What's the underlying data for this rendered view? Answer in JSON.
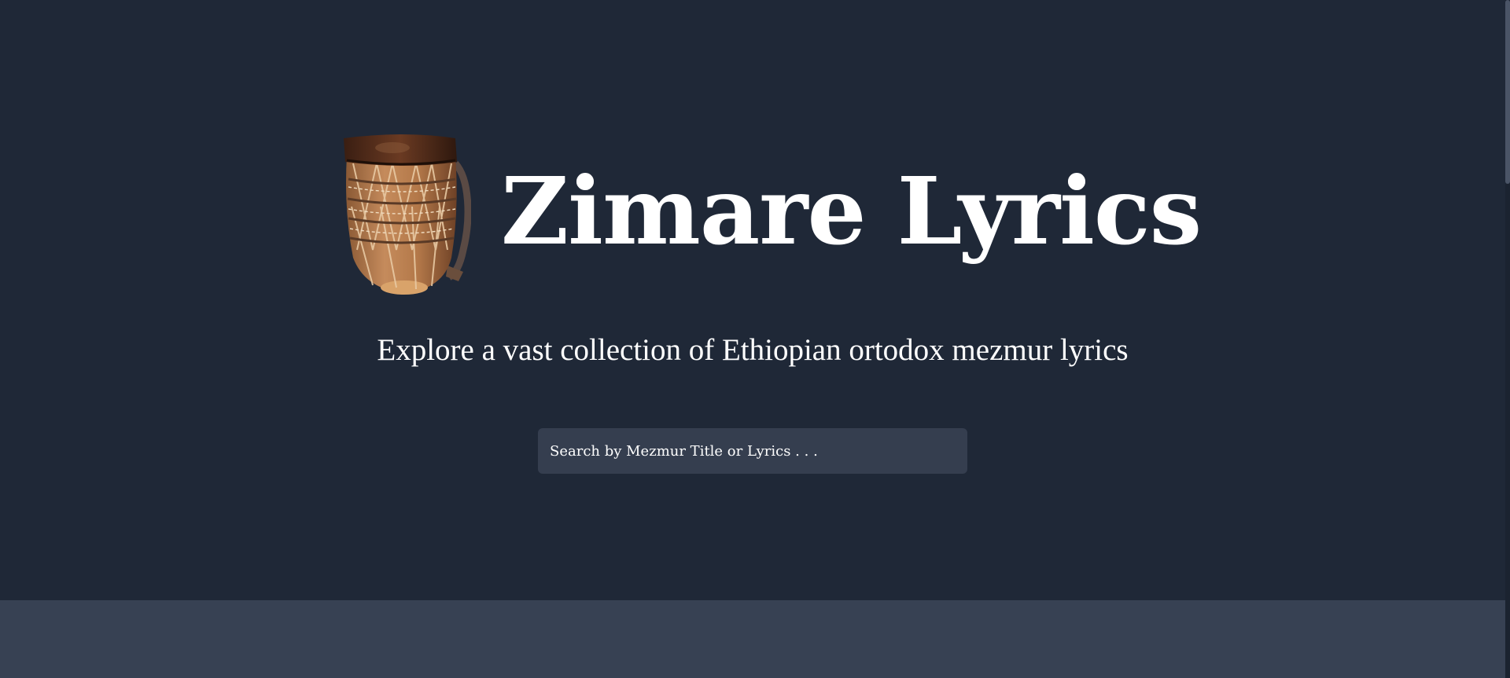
{
  "header": {
    "logo_icon": "kebero-drum-icon",
    "title": "Zimare Lyrics",
    "tagline": "Explore a vast collection of Ethiopian ortodox mezmur lyrics"
  },
  "search": {
    "placeholder": "Search by Mezmur Title or Lyrics . . .",
    "value": ""
  },
  "colors": {
    "background": "#1f2837",
    "search_background": "#353e4f",
    "lower_band": "#374153",
    "text": "#ffffff"
  }
}
